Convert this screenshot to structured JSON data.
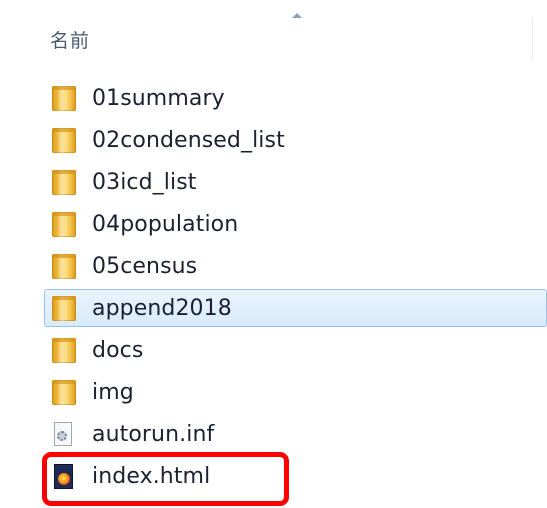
{
  "explorer": {
    "column_header": "名前",
    "items": [
      {
        "name": "01summary",
        "icon": "folder-icon"
      },
      {
        "name": "02condensed_list",
        "icon": "folder-icon"
      },
      {
        "name": "03icd_list",
        "icon": "folder-icon"
      },
      {
        "name": "04population",
        "icon": "folder-icon"
      },
      {
        "name": "05census",
        "icon": "folder-icon"
      },
      {
        "name": "append2018",
        "icon": "folder-icon",
        "selected": true
      },
      {
        "name": "docs",
        "icon": "folder-icon"
      },
      {
        "name": "img",
        "icon": "folder-icon"
      },
      {
        "name": "autorun.inf",
        "icon": "settings-file-icon"
      },
      {
        "name": "index.html",
        "icon": "html-file-icon",
        "highlighted": true
      }
    ]
  },
  "colors": {
    "highlight": "#ff0000",
    "selection_border": "#99c3ec",
    "selection_fill": "#d9ebfb",
    "folder": "#f1bd44"
  }
}
